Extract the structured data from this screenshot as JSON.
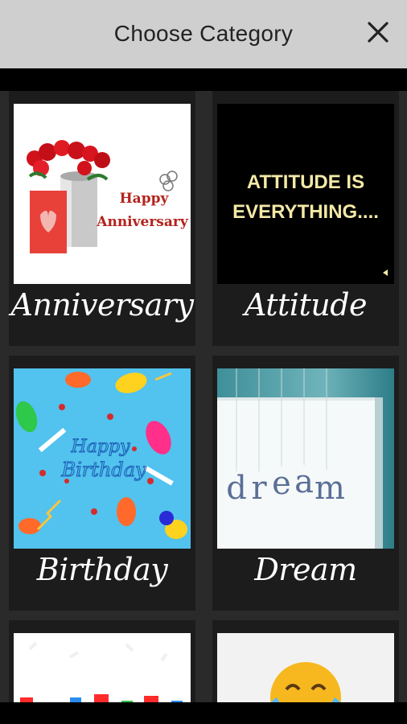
{
  "header": {
    "title": "Choose Category",
    "close_icon": "close-icon"
  },
  "categories": [
    {
      "label": "Anniversary",
      "image_text": [
        "Happy",
        "Anniversary"
      ],
      "image_icon": "roses-card-icon"
    },
    {
      "label": "Attitude",
      "image_text": [
        "ATTITUDE IS",
        "EVERYTHING...."
      ],
      "image_icon": "text-on-black-image"
    },
    {
      "label": "Birthday",
      "image_text": [
        "Happy",
        "Birthday"
      ],
      "image_icon": "balloons-confetti-image"
    },
    {
      "label": "Dream",
      "image_text": [
        "d",
        "r",
        "e",
        "a",
        "m"
      ],
      "image_icon": "hanging-letters-image"
    },
    {
      "label": "",
      "image_icon": "party-items-image"
    },
    {
      "label": "",
      "image_icon": "laughing-emoji-icon"
    }
  ],
  "colors": {
    "header_bg": "#cfcfcf",
    "panel_bg": "#2a2a2a",
    "card_bg": "#1c1c1c",
    "attitude_text": "#f3e9a6",
    "anniversary_text": "#b3231c"
  }
}
